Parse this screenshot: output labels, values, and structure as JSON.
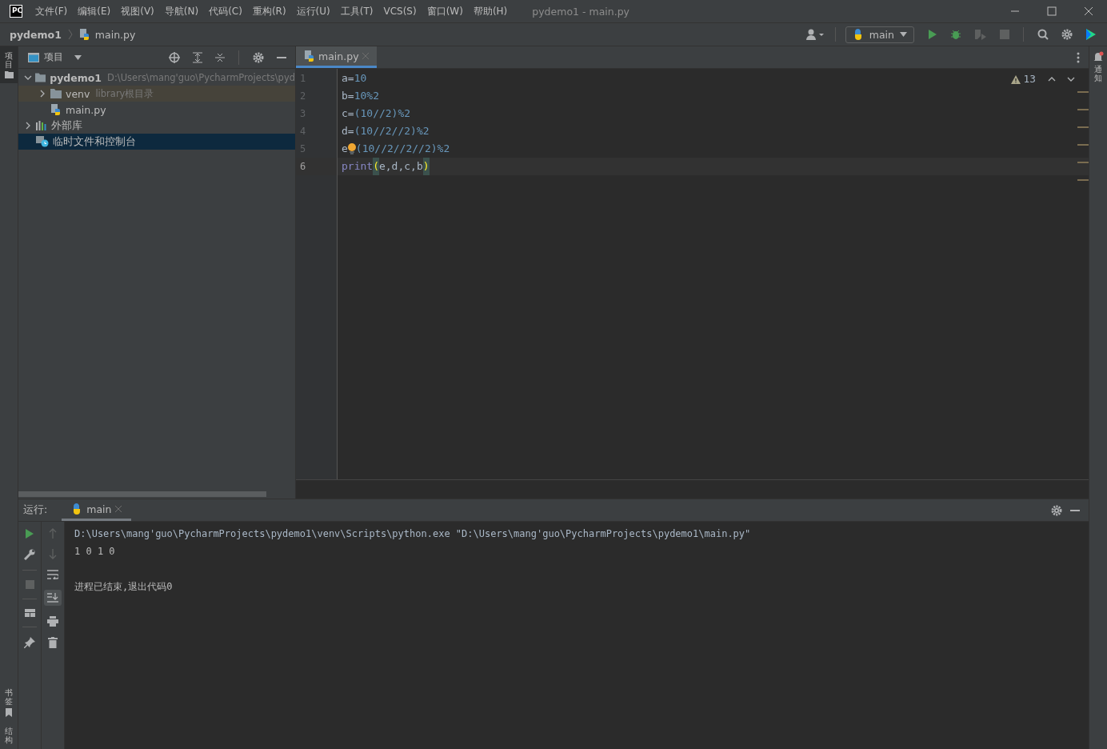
{
  "window": {
    "logo": "PC",
    "title": "pydemo1 - main.py"
  },
  "menu": [
    "文件(F)",
    "编辑(E)",
    "视图(V)",
    "导航(N)",
    "代码(C)",
    "重构(R)",
    "运行(U)",
    "工具(T)",
    "VCS(S)",
    "窗口(W)",
    "帮助(H)"
  ],
  "breadcrumb": [
    "pydemo1",
    "main.py"
  ],
  "run_config": {
    "name": "main"
  },
  "left_stripe": {
    "top": [
      {
        "label": "项目",
        "selected": true
      }
    ],
    "bottom": [
      {
        "label": "书签",
        "selected": false
      },
      {
        "label": "结构",
        "selected": false
      }
    ]
  },
  "project_panel": {
    "title": "项目",
    "tree": [
      {
        "label": "pydemo1",
        "note": "D:\\Users\\mang'guo\\PycharmProjects\\pyd",
        "kind": "folder",
        "bold": true,
        "expanded": true,
        "selected": false,
        "children": [
          {
            "label": "venv",
            "note": "library根目录",
            "kind": "folder",
            "expanded": false,
            "tinted": true,
            "selected": false
          },
          {
            "label": "main.py",
            "kind": "python",
            "selected": false
          }
        ]
      },
      {
        "label": "外部库",
        "kind": "library",
        "expanded": false,
        "selected": false
      },
      {
        "label": "临时文件和控制台",
        "kind": "scratch",
        "selected": true
      }
    ]
  },
  "editor": {
    "tabs": [
      {
        "label": "main.py",
        "selected": true
      }
    ],
    "warnings": "13",
    "lines": [
      {
        "number": "1",
        "current": false,
        "tokens": [
          {
            "text": "a",
            "kind": "name"
          },
          {
            "text": "=",
            "kind": "op"
          },
          {
            "text": "10",
            "kind": "num"
          }
        ]
      },
      {
        "number": "2",
        "current": false,
        "tokens": [
          {
            "text": "b",
            "kind": "name"
          },
          {
            "text": "=",
            "kind": "op"
          },
          {
            "text": "10%2",
            "kind": "num"
          }
        ]
      },
      {
        "number": "3",
        "current": false,
        "tokens": [
          {
            "text": "c",
            "kind": "name"
          },
          {
            "text": "=",
            "kind": "op"
          },
          {
            "text": "(10//2)",
            "kind": "num"
          },
          {
            "text": "%2",
            "kind": "num"
          }
        ]
      },
      {
        "number": "4",
        "current": false,
        "tokens": [
          {
            "text": "d",
            "kind": "name"
          },
          {
            "text": "=",
            "kind": "op"
          },
          {
            "text": "(10//2//2)",
            "kind": "num"
          },
          {
            "text": "%2",
            "kind": "num"
          }
        ]
      },
      {
        "number": "5",
        "current": false,
        "tokens": [
          {
            "text": "e",
            "kind": "name"
          },
          {
            "kind": "bulb"
          },
          {
            "text": "(10//2//2//2)",
            "kind": "num"
          },
          {
            "text": "%2",
            "kind": "num"
          }
        ]
      },
      {
        "number": "6",
        "current": true,
        "tokens": [
          {
            "text": "print",
            "kind": "builtin"
          },
          {
            "text": "(",
            "kind": "match"
          },
          {
            "text": "e,d,c,b",
            "kind": "name"
          },
          {
            "text": ")",
            "kind": "match"
          }
        ]
      }
    ]
  },
  "run_panel": {
    "label": "运行:",
    "tabs": [
      {
        "label": "main",
        "selected": true
      }
    ],
    "console": [
      {
        "text": "D:\\Users\\mang'guo\\PycharmProjects\\pydemo1\\venv\\Scripts\\python.exe \"D:\\Users\\mang'guo\\PycharmProjects\\pydemo1\\main.py\"",
        "kind": "command"
      },
      {
        "text": "1 0 1 0",
        "kind": "output"
      },
      {
        "text": "进程已结束,退出代码0",
        "kind": "exit"
      }
    ]
  },
  "right_stripe": {
    "items": [
      {
        "label": "通知",
        "selected": false
      }
    ]
  }
}
